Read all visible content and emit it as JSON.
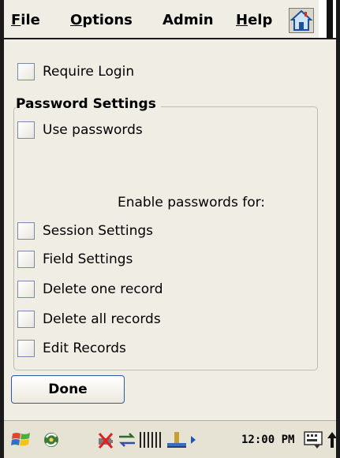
{
  "menubar": {
    "items": [
      {
        "label": "File",
        "accel": "F",
        "rest": "ile"
      },
      {
        "label": "Options",
        "accel": "O",
        "rest": "ptions"
      },
      {
        "label": "Admin",
        "accel": "",
        "rest": "Admin"
      },
      {
        "label": "Help",
        "accel": "H",
        "rest": "elp"
      }
    ],
    "home_icon": "home-icon"
  },
  "require_login": {
    "label": "Require Login",
    "checked": false
  },
  "password_settings": {
    "title": "Password Settings",
    "use_passwords": {
      "label": "Use passwords",
      "checked": false
    },
    "enable_text": "Enable passwords for:",
    "options": [
      {
        "label": "Session Settings",
        "checked": false
      },
      {
        "label": "Field Settings",
        "checked": false
      },
      {
        "label": "Delete one record",
        "checked": false
      },
      {
        "label": "Delete all records",
        "checked": false
      },
      {
        "label": "Edit Records",
        "checked": false
      }
    ]
  },
  "done_label": "Done",
  "taskbar": {
    "clock": "12:00 PM",
    "icons": [
      "start-icon",
      "sync-icon",
      "battery-alert-icon",
      "connection-icon",
      "signal-icon",
      "usb-icon",
      "volume-icon",
      "input-panel-icon",
      "up-arrow-icon"
    ]
  }
}
